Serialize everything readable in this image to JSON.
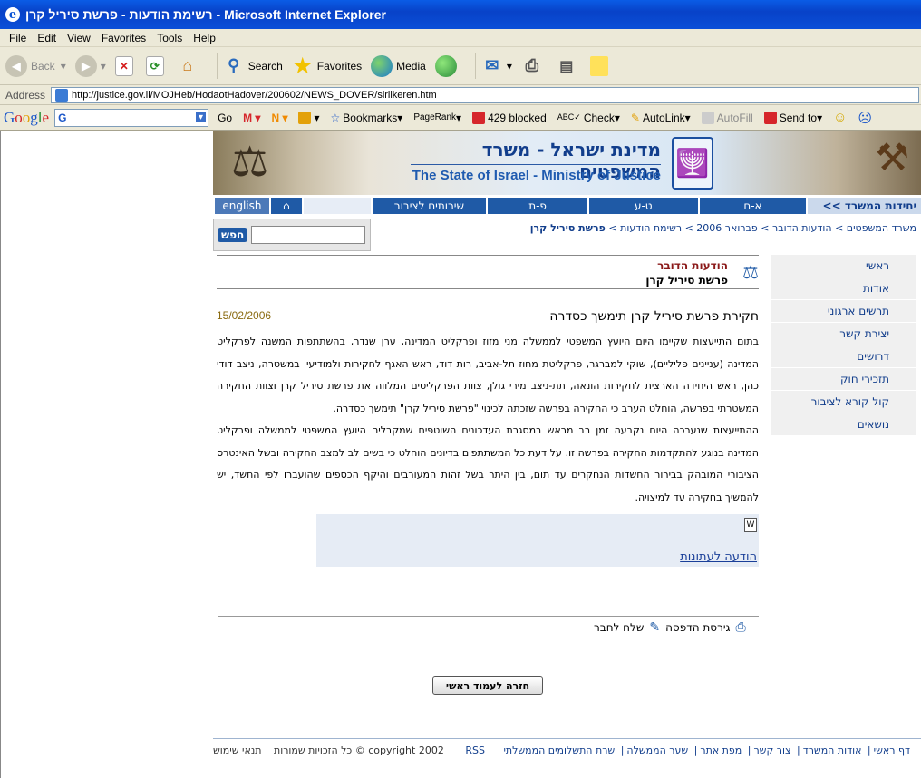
{
  "window": {
    "title": "רשימת הודעות - פרשת סיריל קרן - Microsoft Internet Explorer"
  },
  "menu": [
    "File",
    "Edit",
    "View",
    "Favorites",
    "Tools",
    "Help"
  ],
  "toolbar": {
    "back": "Back",
    "search": "Search",
    "favorites": "Favorites",
    "media": "Media"
  },
  "address": {
    "label": "Address",
    "url": "http://justice.gov.il/MOJHeb/HodaotHadover/200602/NEWS_DOVER/sirilkeren.htm"
  },
  "google_toolbar": {
    "go": "Go",
    "bookmarks": "Bookmarks",
    "pagerank": "PageRank",
    "blocked": "429 blocked",
    "check": "Check",
    "autolink": "AutoLink",
    "autofill": "AutoFill",
    "sendto": "Send to"
  },
  "banner": {
    "heb_title": "מדינת ישראל - משרד המשפטים",
    "eng_title": "The State of Israel - Ministry of Justice"
  },
  "nav": {
    "units": "יחידות המשרד >>",
    "a_h": "א-ח",
    "t_a": "ט-ע",
    "p_t": "פ-ת",
    "services": "שירותים לציבור",
    "english": "english"
  },
  "search": {
    "button": "חפש"
  },
  "breadcrumb": {
    "items": [
      "משרד המשפטים",
      "הודעות הדובר",
      "פברואר 2006",
      "רשימת הודעות"
    ],
    "current": "פרשת סיריל קרן",
    "sep": ">"
  },
  "sidebar": [
    "ראשי",
    "אודות",
    "תרשים ארגוני",
    "יצירת קשר",
    "דרושים",
    "תזכירי חוק",
    "קול קורא לציבור",
    "נושאים"
  ],
  "content": {
    "section": "הודעות הדובר",
    "subject": "פרשת סיריל קרן",
    "title": "חקירת פרשת סיריל קרן תימשך כסדרה",
    "date": "15/02/2006",
    "para1": "בתום התייעצות שקיימו היום היועץ המשפטי לממשלה מני מזוז ופרקליט המדינה, ערן שנדר, בהשתתפות המשנה לפרקליט המדינה (עניינים פליליים), שוקי למברגר, פרקליטת מחוז תל-אביב, רות דוד, ראש האגף לחקירות ולמודיעין במשטרה, ניצב דודי כהן, ראש היחידה הארצית לחקירות הונאה, תת-ניצב מירי גולן, צוות הפרקליטים המלווה את פרשת סיריל קרן וצוות החקירה המשטרתי בפרשה, הוחלט הערב כי החקירה בפרשה שזכתה לכינוי \"פרשת סיריל קרן\" תימשך כסדרה.",
    "para2": "ההתייעצות שנערכה היום נקבעה זמן רב מראש במסגרת העדכונים השוטפים שמקבלים היועץ המשפטי לממשלה ופרקליט המדינה בנוגע להתקדמות החקירה בפרשה זו. על דעת כל המשתתפים בדיונים הוחלט כי בשים לב למצב החקירה ובשל האינטרס הציבורי המובהק בבירור החשדות הנחקרים עד תום, בין היתר בשל זהות המעורבים והיקף הכספים שהועברו לפי החשד, יש להמשיך בחקירה עד למיצויה.",
    "attachment_link": "הודעה לעתונות"
  },
  "tools": {
    "print": "גירסת הדפסה",
    "send": "שלח לחבר"
  },
  "back_button": "חזרה לעמוד ראשי",
  "footer": {
    "links": [
      "דף ראשי",
      "אודות המשרד",
      "צור קשר",
      "מפת אתר",
      "שער הממשלה",
      "שרת התשלומים הממשלתי",
      "RSS"
    ],
    "copyright": "copyright 2002 © כל הזכויות שמורות",
    "terms": "תנאי שימוש"
  }
}
